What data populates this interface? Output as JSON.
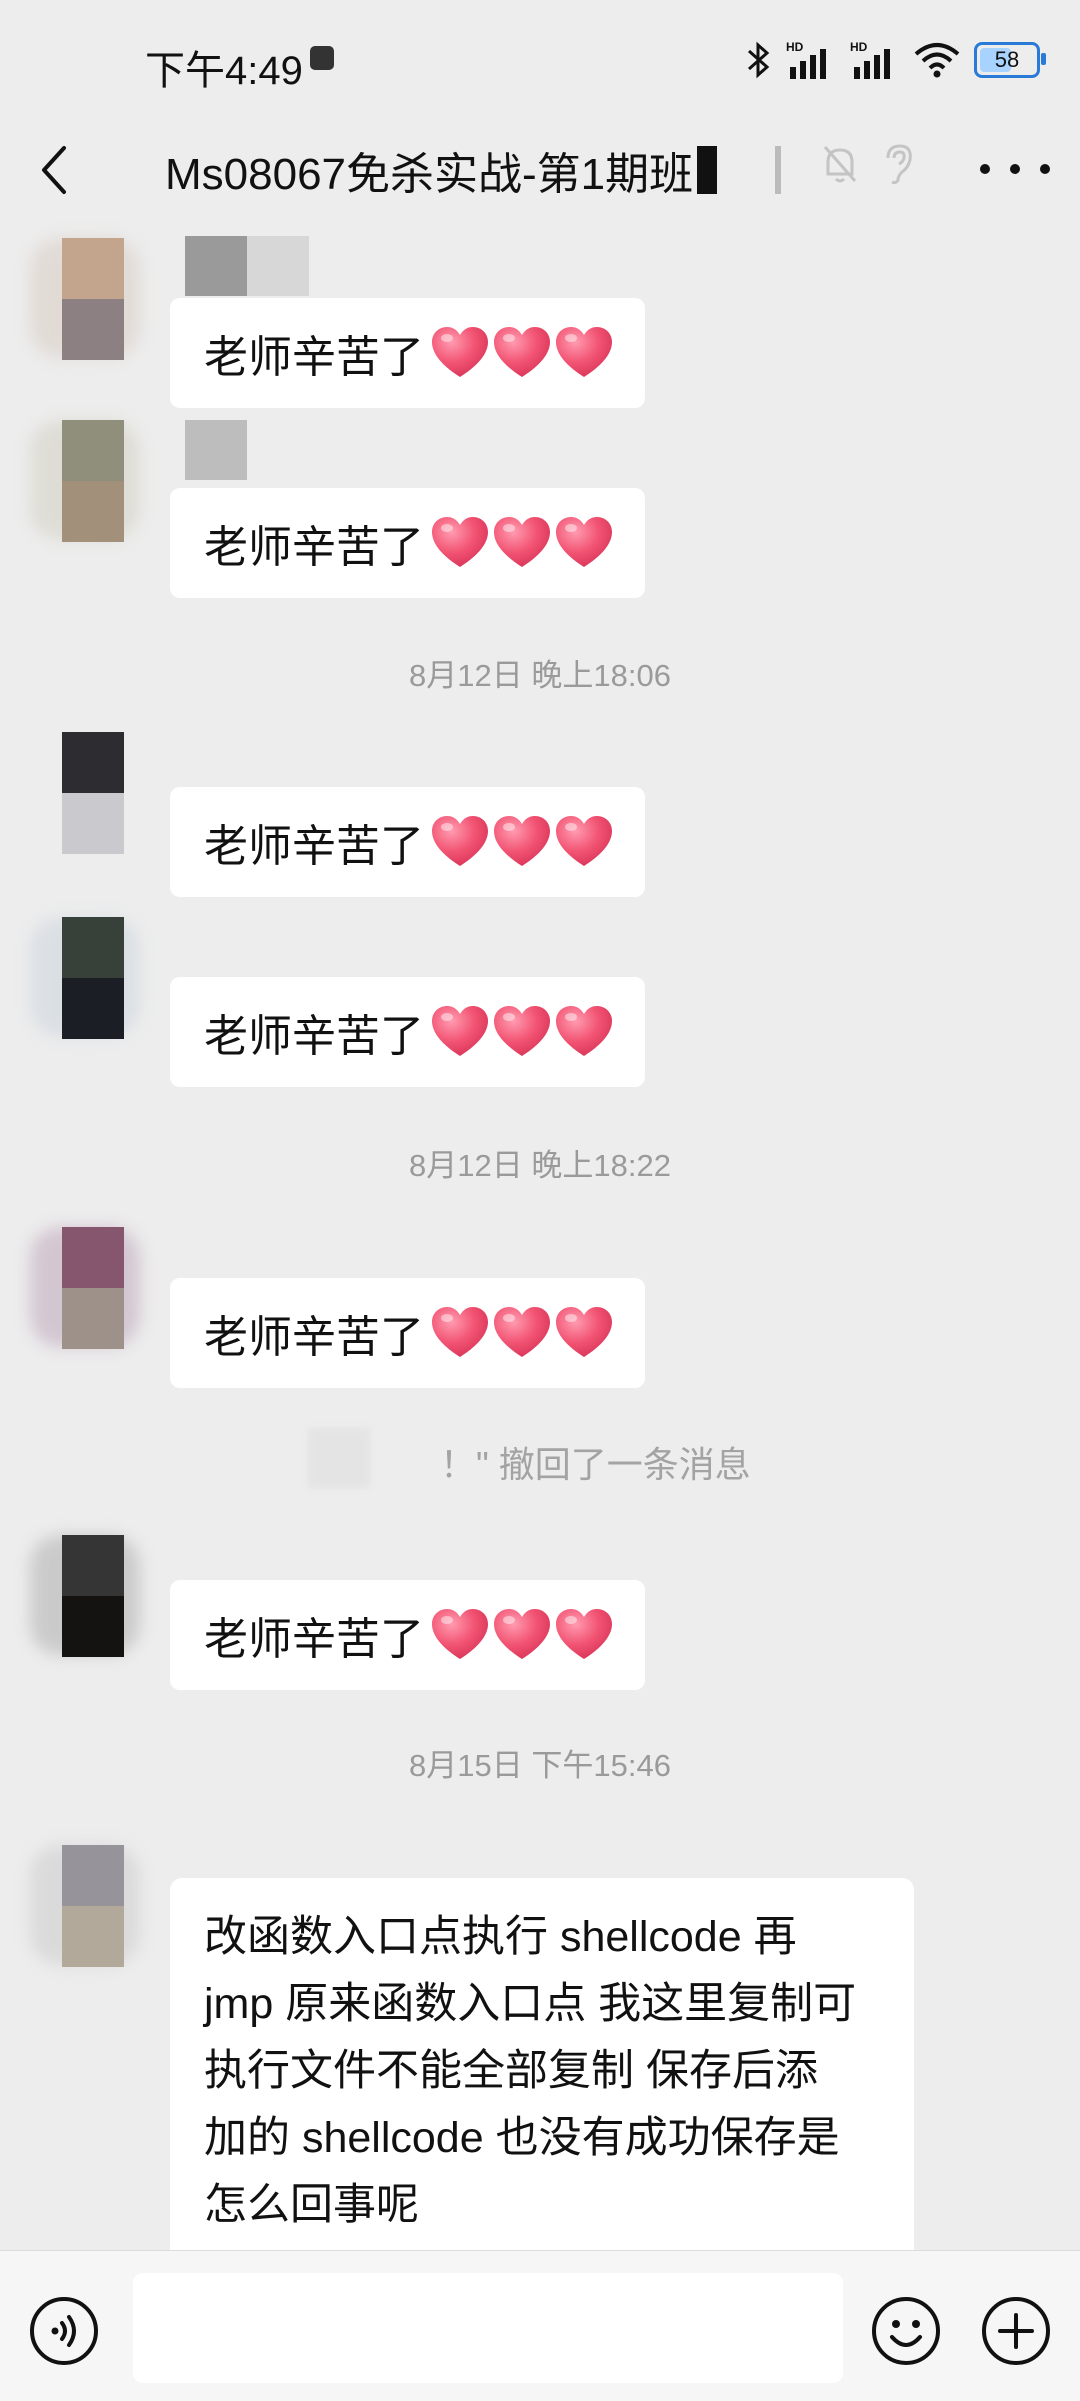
{
  "status_bar": {
    "time": "下午4:49",
    "battery": 58,
    "battery_label": "58",
    "icons": [
      "bluetooth-icon",
      "signal-hd-1-icon",
      "signal-hd-2-icon",
      "wifi-icon",
      "battery-icon"
    ]
  },
  "header": {
    "title": "Ms08067免杀实战-第1期班",
    "icons": [
      "back-arrow-icon",
      "mute-bell-icon",
      "ear-icon",
      "more-dots-icon"
    ]
  },
  "messages": [
    {
      "type": "text",
      "text": "老师辛苦了",
      "emoji": "heart-emoji",
      "emoji_count": 3
    },
    {
      "type": "text",
      "text": "老师辛苦了",
      "emoji": "heart-emoji",
      "emoji_count": 3
    },
    {
      "type": "time",
      "text": "8月12日 晚上18:06"
    },
    {
      "type": "text",
      "text": "老师辛苦了",
      "emoji": "heart-emoji",
      "emoji_count": 3
    },
    {
      "type": "text",
      "text": "老师辛苦了",
      "emoji": "heart-emoji",
      "emoji_count": 3
    },
    {
      "type": "time",
      "text": "8月12日 晚上18:22"
    },
    {
      "type": "text",
      "text": "老师辛苦了",
      "emoji": "heart-emoji",
      "emoji_count": 3
    },
    {
      "type": "recall",
      "text": "！\" 撤回了一条消息"
    },
    {
      "type": "text",
      "text": "老师辛苦了",
      "emoji": "heart-emoji",
      "emoji_count": 3
    },
    {
      "type": "time",
      "text": "8月15日 下午15:46"
    },
    {
      "type": "long_text",
      "lines": [
        "改函数入口点执行 shellcode 再",
        "jmp 原来函数入口点 我这里复制可",
        "执行文件不能全部复制 保存后添",
        "加的 shellcode 也没有成功保存是",
        "怎么回事呢"
      ]
    }
  ],
  "input_bar": {
    "placeholder": "",
    "icons": [
      "voice-icon",
      "emoji-icon",
      "plus-icon"
    ]
  },
  "colors": {
    "background": "#EDEDED",
    "bubble": "#FFFFFF",
    "heart": "#F0506E",
    "battery_accent": "#2A7BD8"
  }
}
